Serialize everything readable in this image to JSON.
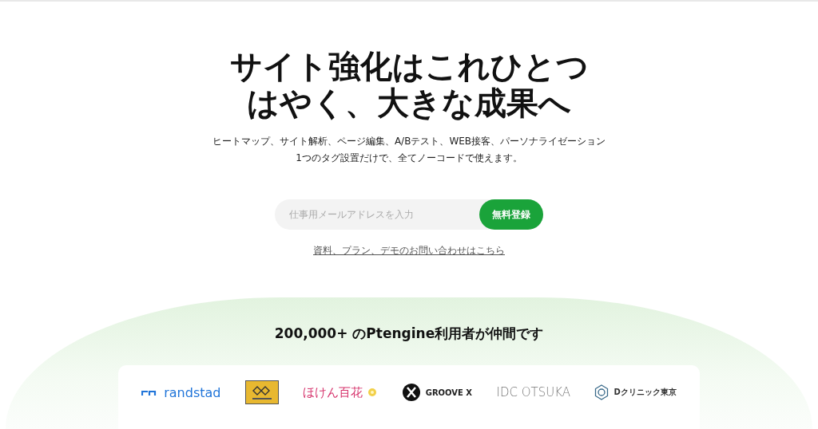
{
  "hero": {
    "title_lines": [
      "サイト強化はこれひとつ",
      "はやく、大きな成果へ"
    ],
    "description_lines": [
      "ヒートマップ、サイト解析、ページ編集、A/Bテスト、WEB接客、パーソナライゼーション",
      "1つのタグ設置だけで、全てノーコードで使えます。"
    ],
    "signup": {
      "placeholder": "仕事用メールアドレスを入力",
      "button": "無料登録"
    },
    "contact_link": "資料、プラン、デモのお問い合わせはこちら"
  },
  "customers": {
    "heading": "200,000+ のPtengine利用者が仲間です",
    "logos": [
      {
        "kind": "randstad",
        "text": "randstad"
      },
      {
        "kind": "geo"
      },
      {
        "kind": "hoken",
        "text": "ほけん百花"
      },
      {
        "kind": "groove",
        "text": "GROOVE X"
      },
      {
        "kind": "otsuka",
        "text": "IDC OTSUKA"
      },
      {
        "kind": "dclinic",
        "text": "Dクリニック東京"
      }
    ]
  }
}
